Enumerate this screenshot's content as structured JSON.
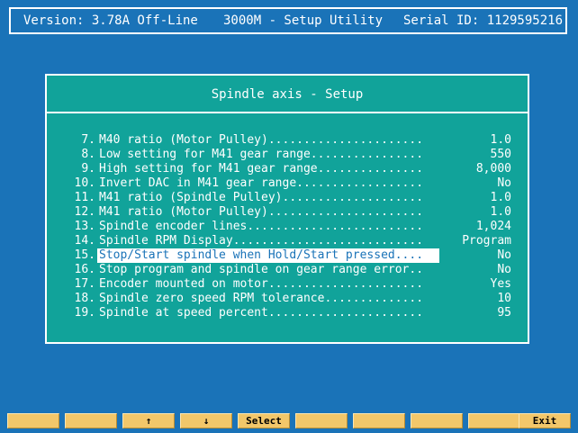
{
  "title_bar": {
    "version": "Version: 3.78A Off-Line",
    "app_name": "3000M - Setup Utility",
    "serial": "Serial ID: 1129595216"
  },
  "panel": {
    "title": "Spindle axis - Setup",
    "rows": [
      {
        "num": "7.",
        "label": "M40 ratio (Motor Pulley)......................",
        "value": "1.0"
      },
      {
        "num": "8.",
        "label": "Low setting for M41 gear range................",
        "value": "550"
      },
      {
        "num": "9.",
        "label": "High setting for M41 gear range...............",
        "value": "8,000"
      },
      {
        "num": "10.",
        "label": "Invert DAC in M41 gear range..................",
        "value": "No"
      },
      {
        "num": "11.",
        "label": "M41 ratio (Spindle Pulley)....................",
        "value": "1.0"
      },
      {
        "num": "12.",
        "label": "M41 ratio (Motor Pulley)......................",
        "value": "1.0"
      },
      {
        "num": "13.",
        "label": "Spindle encoder lines.........................",
        "value": "1,024"
      },
      {
        "num": "14.",
        "label": "Spindle RPM Display...........................",
        "value": "Program"
      },
      {
        "num": "15.",
        "label": "Stop/Start spindle when Hold/Start pressed....",
        "value": "No"
      },
      {
        "num": "16.",
        "label": "Stop program and spindle on gear range error..",
        "value": "No"
      },
      {
        "num": "17.",
        "label": "Encoder mounted on motor......................",
        "value": "Yes"
      },
      {
        "num": "18.",
        "label": "Spindle zero speed RPM tolerance..............",
        "value": "10"
      },
      {
        "num": "19.",
        "label": "Spindle at speed percent......................",
        "value": "95"
      }
    ],
    "selected_row": "15."
  },
  "function_keys": [
    {
      "label": ""
    },
    {
      "label": ""
    },
    {
      "label": "↑",
      "icon": "arrow-up-icon"
    },
    {
      "label": "↓",
      "icon": "arrow-down-icon"
    },
    {
      "label": "Select"
    },
    {
      "label": ""
    },
    {
      "label": ""
    },
    {
      "label": ""
    },
    {
      "label": ""
    },
    {
      "label": "Exit"
    }
  ],
  "colors": {
    "background": "#1a73b8",
    "panel": "#11a39a",
    "function_key": "#f2c76a",
    "selection_highlight": "#ffffff"
  }
}
